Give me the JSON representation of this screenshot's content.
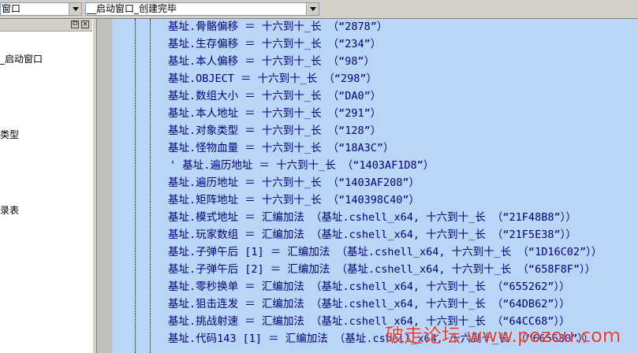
{
  "toolbar": {
    "combo_left": "窗口",
    "combo_right": "__启动窗口_创建完毕"
  },
  "left_panel": {
    "btn_a": "ㅁ",
    "btn_b": "×",
    "items": [
      {
        "label": "_启动窗口"
      },
      {
        "label": "类型"
      },
      {
        "label": "录表"
      }
    ]
  },
  "code": {
    "lines": [
      "基址.骨骼偏移 ＝ 十六到十_长 （“2878”）",
      "基址.生存偏移 ＝ 十六到十_长 （“234”）",
      "基址.本人偏移 ＝ 十六到十_长 （“98”）",
      "基址.OBJECT ＝ 十六到十_长 （“298”）",
      "基址.数组大小 ＝ 十六到十_长 （“DA0”）",
      "基址.本人地址 ＝ 十六到十_长 （“291”）",
      "基址.对象类型 ＝ 十六到十_长 （“128”）",
      "基址.怪物血量 ＝ 十六到十_长 （“18A3C”）",
      "' 基址.遍历地址 ＝ 十六到十_长 （“1403AF1D8”）",
      "基址.遍历地址 ＝ 十六到十_长 （“1403AF208”）",
      "基址.矩阵地址 ＝ 十六到十_长 （“140398C40”）",
      "基址.模式地址 ＝ 汇编加法 （基址.cshell_x64, 十六到十_长 （“21F48B8”））",
      "基址.玩家数组 ＝ 汇编加法 （基址.cshell_x64, 十六到十_长 （“21F5E38”））",
      "基址.子弹午后 [1] ＝ 汇编加法 （基址.cshell_x64, 十六到十_长 （“1D16C02”））",
      "基址.子弹午后 [2] ＝ 汇编加法 （基址.cshell_x64, 十六到十_长 （“658F8F”））",
      "基址.零秒换单 ＝ 汇编加法 （基址.cshell_x64, 十六到十_长 （“655262”））",
      "基址.狙击连发 ＝ 汇编加法 （基址.cshell_x64, 十六到十_长 （“64DB62”））",
      "基址.挑战射速 ＝ 汇编加法 （基址.cshell_x64, 十六到十_长 （“64CC68”））",
      "基址.代码143 [1] ＝ 汇编加法 （基址.cshell_x64, 十六到十_长 （“665630”））"
    ]
  },
  "watermark": "破走论坛 www.pozou.com",
  "colors": {
    "code_text": "#000080",
    "selection_bg": "#b9d5f7",
    "watermark": "#e03020"
  }
}
